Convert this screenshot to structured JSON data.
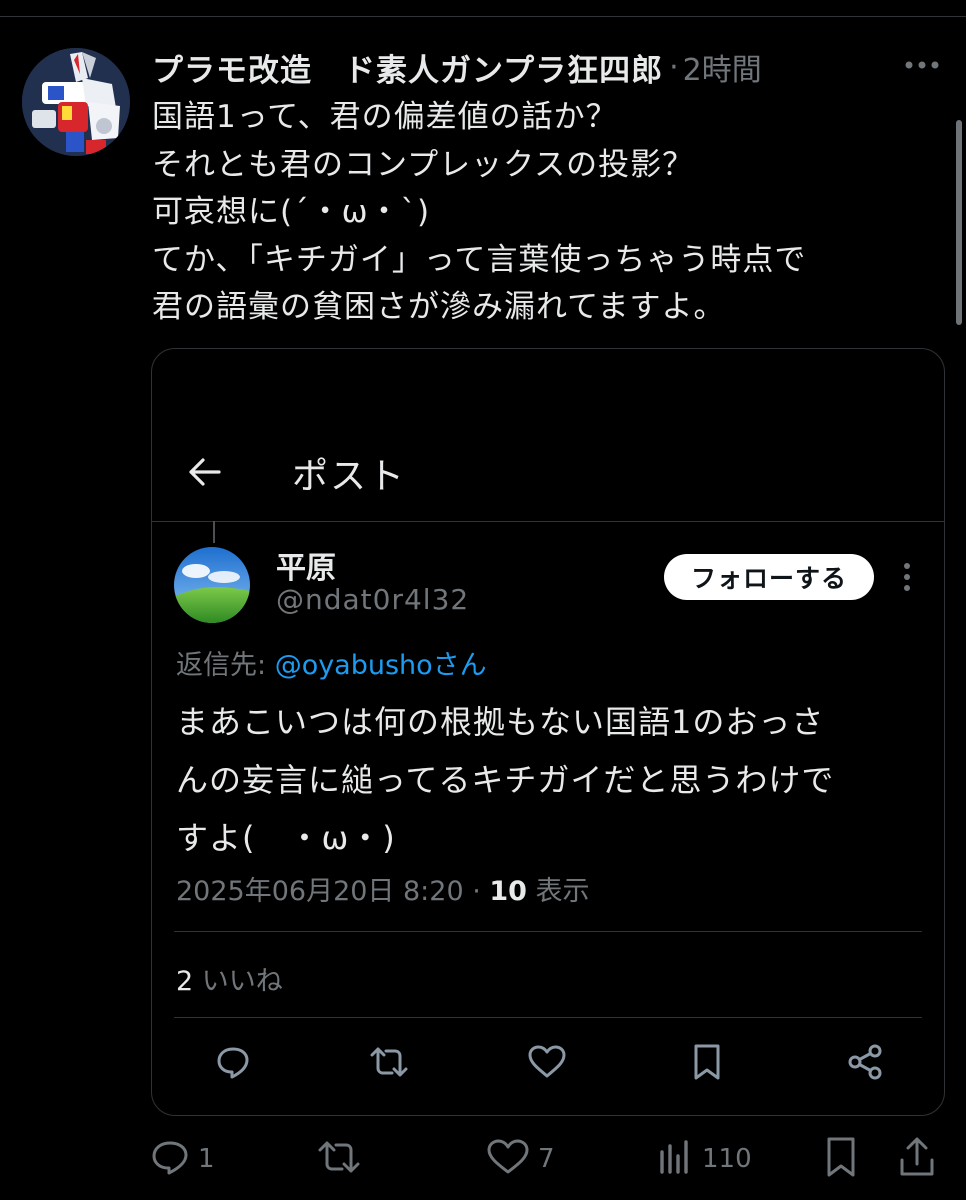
{
  "post": {
    "author_name": "プラモ改造　ド素人ガンプラ狂四郎",
    "separator": "·",
    "time": "2時間",
    "more_icon": "more-horizontal-icon",
    "lines": [
      "国語1って、君の偏差値の話か？",
      "それとも君のコンプレックスの投影？",
      "可哀想に(´・ω・`)",
      "てか、「キチガイ」って言葉使っちゃう時点で",
      "君の語彙の貧困さが滲み漏れてますよ。"
    ],
    "actions": {
      "reply_count": "1",
      "repost_count": "",
      "like_count": "7",
      "view_count": "110"
    }
  },
  "embed": {
    "back_icon": "arrow-left-icon",
    "title": "ポスト",
    "reply": {
      "name": "平原",
      "handle": "@ndat0r4l32",
      "follow_label": "フォローする",
      "replying_prefix": "返信先: ",
      "replying_handle": "@oyabushoさん",
      "lines": [
        "まあこいつは何の根拠もない国語1のおっさ",
        "んの妄言に縋ってるキチガイだと思うわけで",
        "すよ(　・ω・)"
      ],
      "timestamp": "2025年06月20日 8:20 · ",
      "views_num": "10",
      "views_label": " 表示",
      "likes_num": "2",
      "likes_label": " いいね"
    }
  },
  "colors": {
    "background": "#000000",
    "text": "#e7e9ea",
    "muted": "#71767b",
    "link": "#1d9bf0",
    "border": "#2f3336"
  }
}
